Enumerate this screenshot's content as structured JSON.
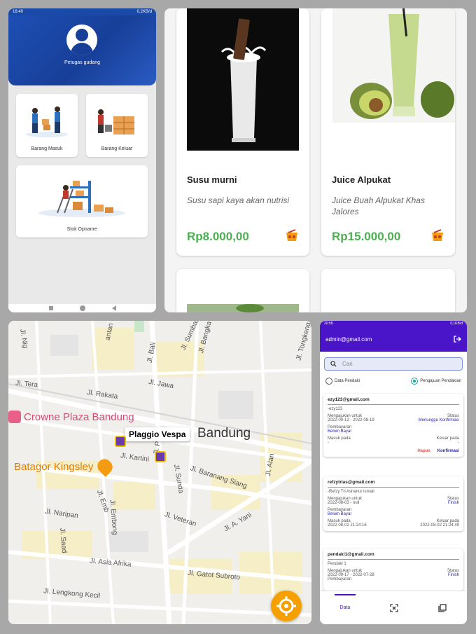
{
  "warehouse": {
    "status_time": "16:40",
    "status_info": "0,2KB/d",
    "role": "Petugas gudang",
    "menu": [
      "Barang Masuk",
      "Barang Keluar",
      "Stok Opname"
    ]
  },
  "products": [
    {
      "name": "Susu murni",
      "desc": "Susu sapi kaya akan nutrisi",
      "price": "Rp8.000,00"
    },
    {
      "name": "Juice Alpukat",
      "desc": "Juice Buah Alpukat Khas Jalores",
      "price": "Rp15.000,00"
    }
  ],
  "map": {
    "city": "Bandung",
    "tooltip": "Plaggio Vespa",
    "poi": [
      "Crowne Plaza Bandung",
      "Batagor Kingsley"
    ],
    "streets": [
      "Jl. Sumbawa",
      "Jl. Bangka",
      "Jl. Tongkeng",
      "Jl. Bali",
      "Jl. Jawa",
      "Jl. Tera",
      "Jl. Rakata",
      "Jl. Kartini",
      "Jl. Pana",
      "Jl. Baranang Siang",
      "Jl. Alan",
      "Jl. Sunda",
      "Jl. Emb",
      "Jl. Veteran",
      "Jl. A. Yani",
      "Jl. Naripan",
      "Jl. Embong",
      "Jl. Saad",
      "Jl. Asia Afrika",
      "Jl. Gatot Subroto",
      "Jl. Lengkong Kecil",
      "Jl. Nig",
      "antan"
    ],
    "accent": "#f6a000"
  },
  "admin": {
    "status_time": "20:58",
    "status_info": "0,1KB/d",
    "email": "admin@gmail.com",
    "search_placeholder": "Cari",
    "radio_options": [
      "Data Pendaki",
      "Pengajuan Pendakian"
    ],
    "labels": {
      "submitted": "Mengajukan untuk",
      "status": "Status",
      "payment": "Pembayaran",
      "enter": "Masuk pada",
      "exit": "Keluar pada",
      "delete": "Hapus",
      "confirm": "Konfirmasi"
    },
    "entries": [
      {
        "email": "ezy123@gmail.com",
        "name": "-ezy123",
        "dates": "2022-09-12 - 2022-08-19",
        "status": "Menunggu Konfirmasi",
        "payment": "Belum Bayar",
        "enter": "-",
        "exit": "-"
      },
      {
        "email": "refzytrias@gmail.com",
        "name": "-Refzy Tri Ashanur Ismail",
        "dates": "2022-08-03 - null",
        "status": "Finish",
        "payment": "Belum Bayar",
        "enter": "2022-08-02 21:24:16",
        "exit": "2022-08-02 21:24:49"
      },
      {
        "email": "pendaki1@gmail.com",
        "name": "Pendaki 1",
        "dates": "2022-09-17 - 2022-07-28",
        "status": "Finish",
        "payment": "Pembayaran"
      }
    ],
    "nav": [
      "Data"
    ]
  }
}
